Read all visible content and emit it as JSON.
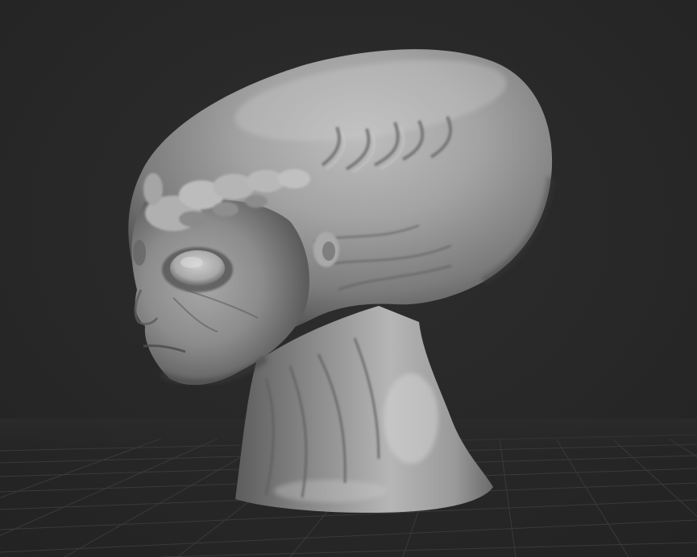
{
  "viewport": {
    "background_color": "#2a2a2a",
    "floor_grid_color": "#3a3a3a",
    "floor_grid_visible": true,
    "model_material_color": "#9a9a9a",
    "model": {
      "label": "",
      "subject": "alien head bust"
    }
  }
}
